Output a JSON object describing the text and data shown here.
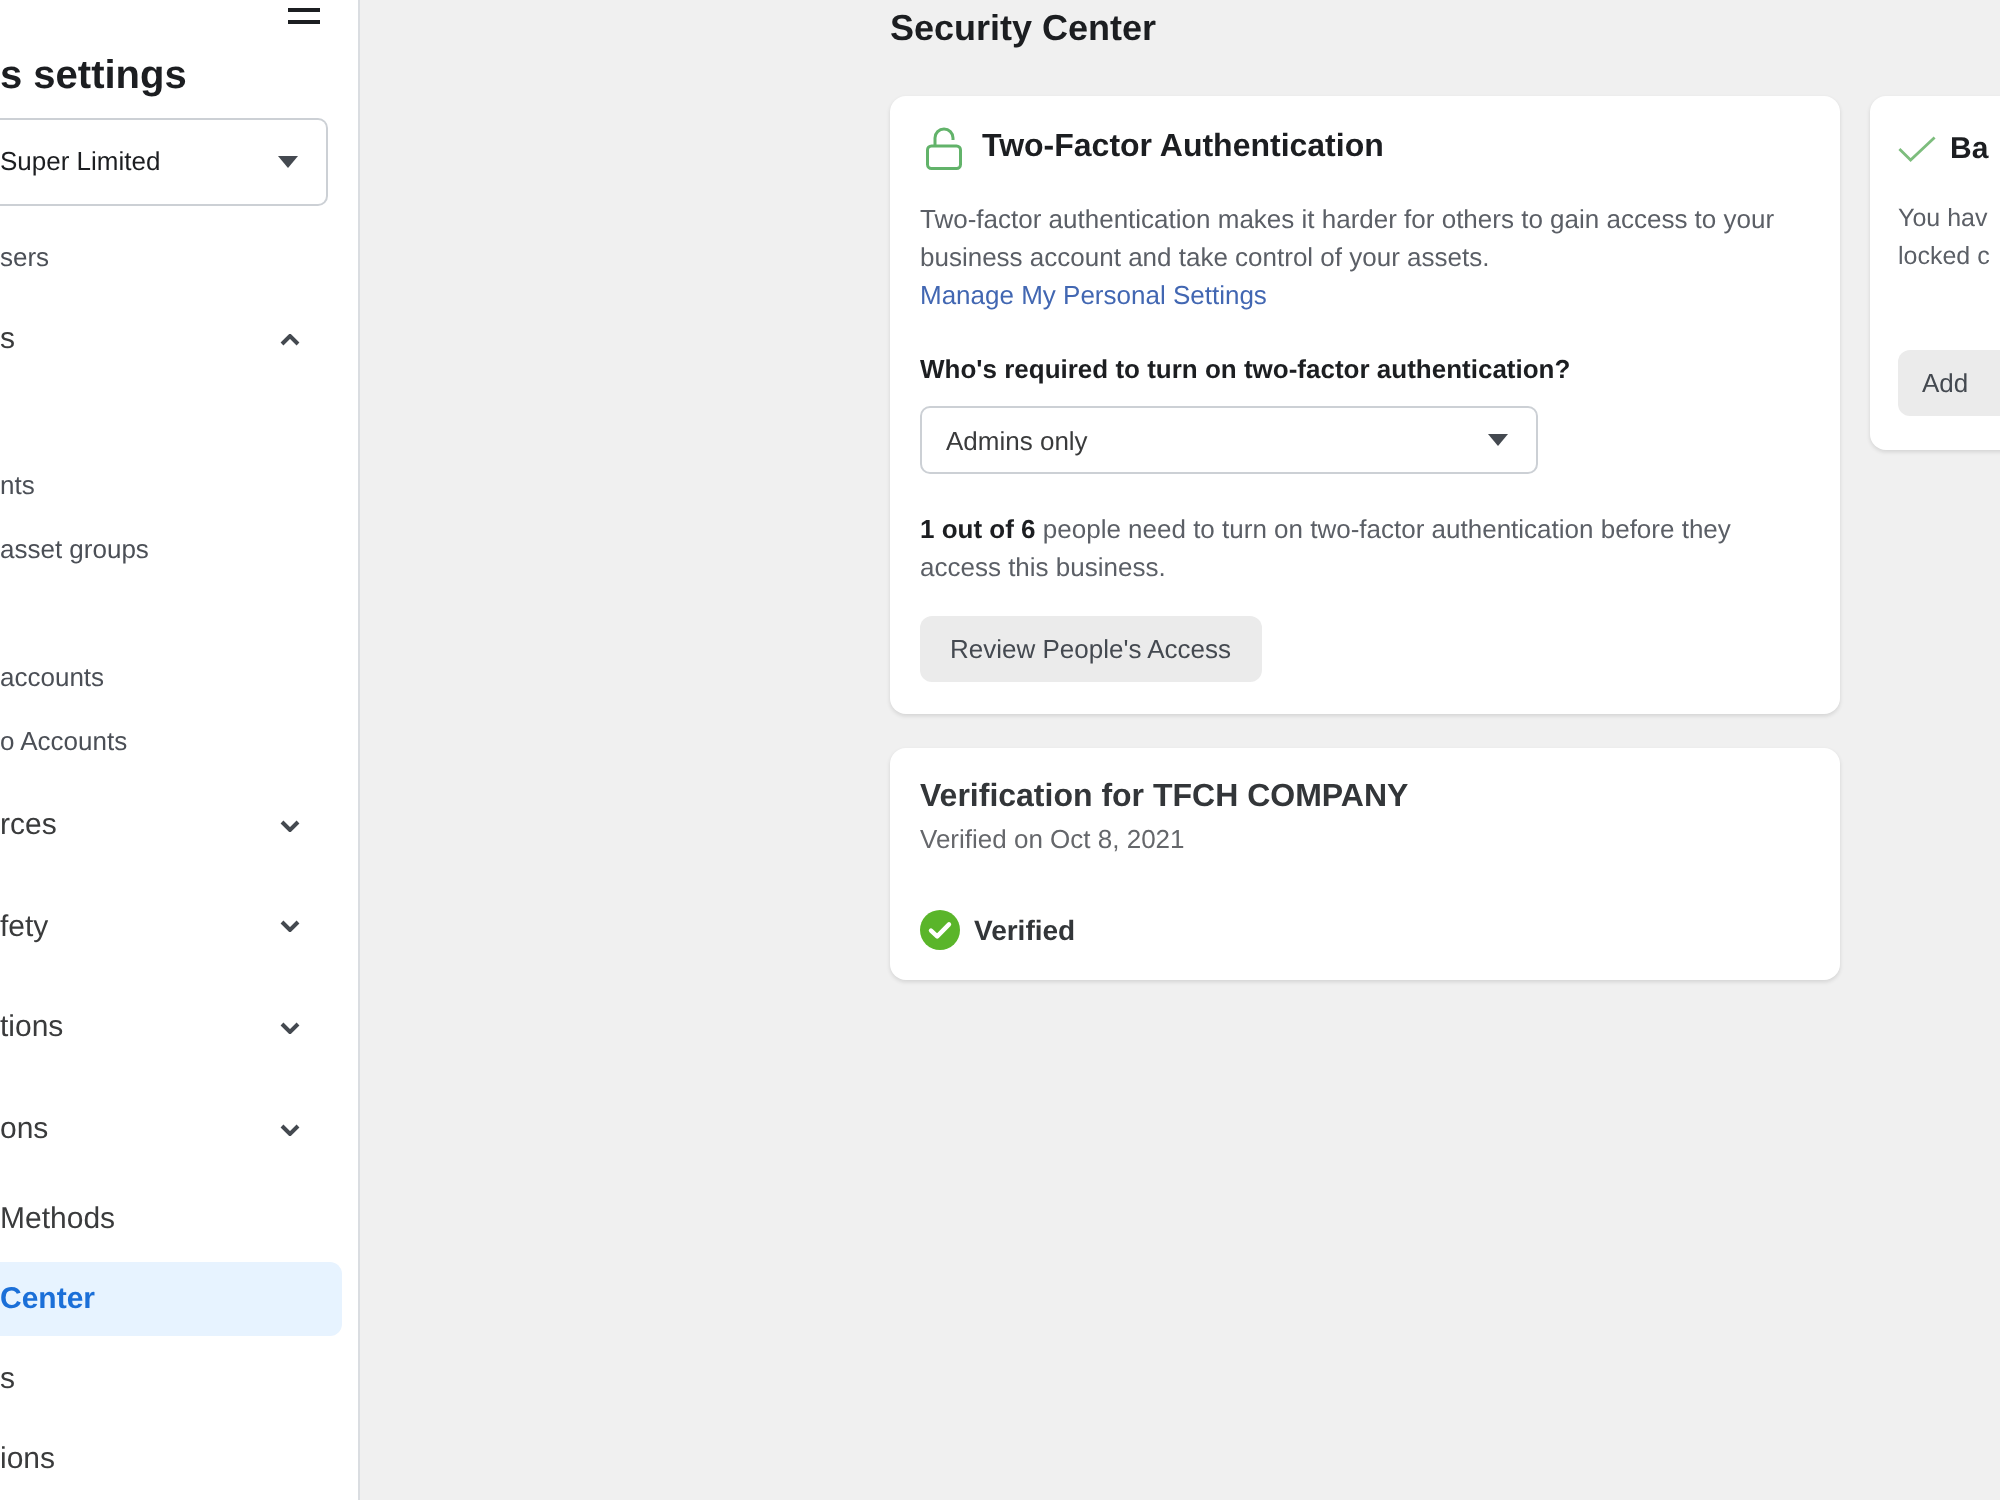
{
  "sidebar": {
    "title": "s settings",
    "business_select": {
      "value": "Super Limited"
    },
    "items": [
      {
        "kind": "sub",
        "label": "sers",
        "selected": false
      },
      {
        "kind": "section",
        "label": "s",
        "expanded": true,
        "selected": false,
        "children": [
          {
            "label": "nts",
            "selected": false
          },
          {
            "label": "asset groups",
            "selected": false
          },
          {
            "label": "accounts",
            "selected": false
          },
          {
            "label": "o Accounts",
            "selected": false
          }
        ]
      },
      {
        "kind": "section",
        "label": "rces",
        "expanded": false,
        "selected": false
      },
      {
        "kind": "section",
        "label": "fety",
        "expanded": false,
        "selected": false
      },
      {
        "kind": "section",
        "label": "tions",
        "expanded": false,
        "selected": false
      },
      {
        "kind": "section",
        "label": "ons",
        "expanded": false,
        "selected": false
      },
      {
        "kind": "page",
        "label": "Methods",
        "selected": false
      },
      {
        "kind": "page",
        "label": "Center",
        "selected": true
      },
      {
        "kind": "page",
        "label": "s",
        "selected": false
      },
      {
        "kind": "page",
        "label": "ions",
        "selected": false
      }
    ]
  },
  "main": {
    "title": "Security Center",
    "two_factor": {
      "title": "Two-Factor Authentication",
      "description": {
        "text": "Two-factor authentication makes it harder for others to gain access to your business account and take control of your assets.",
        "link": "Manage My Personal Settings"
      },
      "question": "Who's required to turn on two-factor authentication?",
      "requirement_select": {
        "value": "Admins only"
      },
      "status_text": "**1 out of 6** people need to turn on two-factor authentication before they access this business.",
      "button": "Review People's Access"
    },
    "verification": {
      "title": "Verification for TFCH COMPANY",
      "subtitle": "Verified on Oct 8, 2021",
      "status": {
        "label": "Verified",
        "verified": true
      }
    },
    "side_card": {
      "title": "Ba",
      "text_lines": [
        "You hav",
        "locked c"
      ],
      "button": "Add"
    }
  }
}
